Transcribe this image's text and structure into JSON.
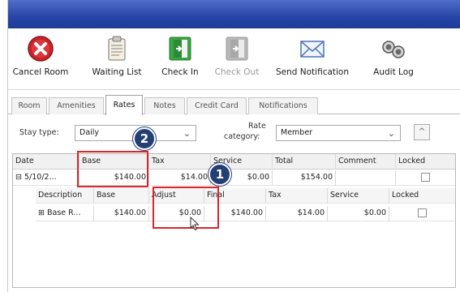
{
  "toolbar": {
    "buttons": [
      {
        "label": "Cancel Room",
        "icon": "cancel-icon",
        "enabled": true
      },
      {
        "label": "Waiting List",
        "icon": "clipboard-icon",
        "enabled": true
      },
      {
        "label": "Check In",
        "icon": "check-in-door-icon",
        "enabled": true
      },
      {
        "label": "Check Out",
        "icon": "check-out-door-icon",
        "enabled": false
      },
      {
        "label": "Send Notification",
        "icon": "envelope-icon",
        "enabled": true
      },
      {
        "label": "Audit Log",
        "icon": "binoculars-icon",
        "enabled": true
      }
    ]
  },
  "tabs": [
    {
      "label": "Room",
      "active": false
    },
    {
      "label": "Amenities",
      "active": false
    },
    {
      "label": "Rates",
      "active": true
    },
    {
      "label": "Notes",
      "active": false
    },
    {
      "label": "Credit Card",
      "active": false
    },
    {
      "label": "Notifications",
      "active": false
    }
  ],
  "filters": {
    "stay_type_label": "Stay type:",
    "stay_type_value": "Daily",
    "rate_category_label_1": "Rate",
    "rate_category_label_2": "category:",
    "rate_category_value": "Member",
    "dropdown_glyph": "⌄",
    "collapse_glyph": "^"
  },
  "grid": {
    "headers": [
      "Date",
      "Base",
      "Tax",
      "Service",
      "Total",
      "Comment",
      "Locked"
    ],
    "row": {
      "expand": "⊟",
      "date": "5/10/2...",
      "base": "$140.00",
      "tax": "$14.00",
      "service": "$0.00",
      "total": "$154.00",
      "comment": "",
      "locked": false
    },
    "sub_headers": [
      "Description",
      "Base",
      "Adjust",
      "Final",
      "Tax",
      "Service",
      "Locked"
    ],
    "sub_row": {
      "expand": "⊞",
      "description": "Base R...",
      "base": "$140.00",
      "adjust": "$0.00",
      "final": "$140.00",
      "tax": "$14.00",
      "service": "$0.00",
      "locked": false
    }
  },
  "callouts": {
    "badge_1": "1",
    "badge_2": "2",
    "color": "#d9252b",
    "badge_color": "#233f73"
  },
  "colors": {
    "titlebar": "#2745a8"
  }
}
